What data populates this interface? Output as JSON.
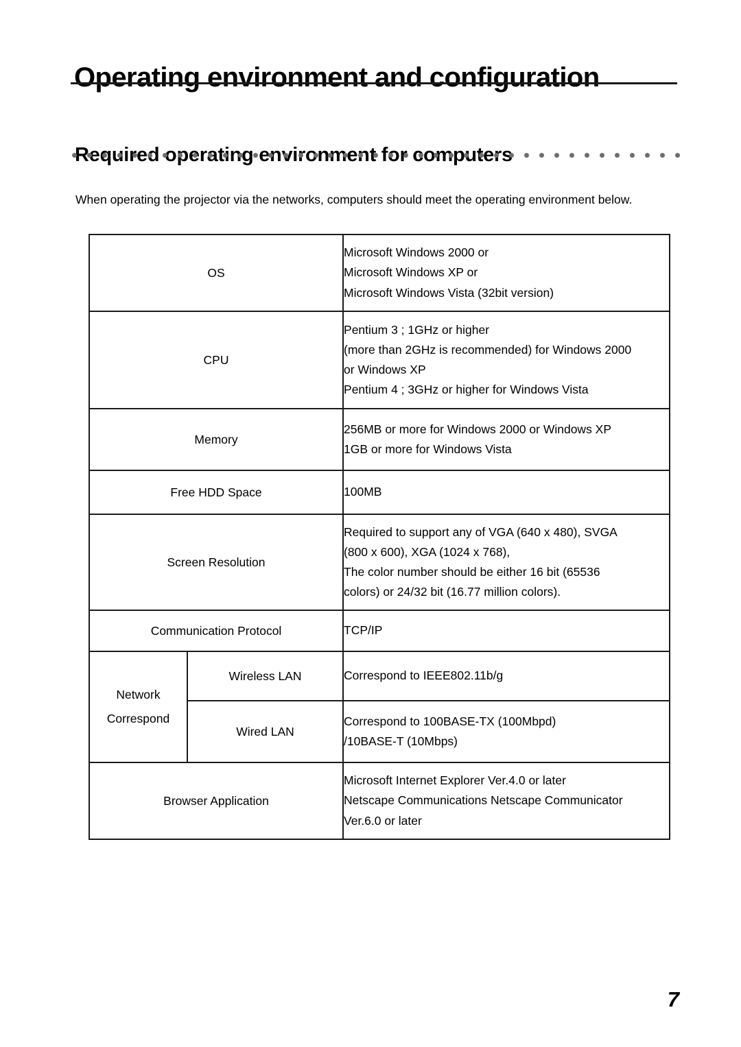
{
  "page": {
    "title": "Operating environment and configuration",
    "section_heading": "Required operating environment for computers",
    "intro_line1": "When operating the projector via the networks, computers should meet the operating environment",
    "intro_line2": "below.",
    "page_number": "7",
    "rule_color": "#1a1a1a",
    "dot_color": "#6e6e6e",
    "dot_count": 41
  },
  "spec_table": {
    "rows": [
      {
        "label": "OS",
        "value_lines": [
          "Microsoft Windows 2000 or",
          "Microsoft Windows XP or",
          "Microsoft Windows Vista (32bit version)"
        ]
      },
      {
        "label": "CPU",
        "value_lines": [
          "Pentium 3 ;  1GHz or higher",
          "(more than 2GHz is recommended) for Windows 2000",
          "or Windows XP",
          "Pentium 4 ;  3GHz or higher  for Windows Vista"
        ]
      },
      {
        "label": "Memory",
        "value_lines": [
          "256MB or more for Windows 2000 or Windows XP",
          "1GB or more for Windows Vista"
        ]
      },
      {
        "label": "Free HDD Space",
        "value_lines": [
          "100MB"
        ]
      },
      {
        "label": "Screen Resolution",
        "value_lines": [
          "Required to support any of VGA (640 x 480), SVGA",
          "(800 x 600), XGA (1024 x 768),",
          "The color number should be either 16 bit (65536",
          "colors) or 24/32 bit (16.77 million colors)."
        ]
      },
      {
        "label": "Communication Protocol",
        "value_lines": [
          "TCP/IP"
        ]
      },
      {
        "label_line1": "Network",
        "label_line2": "Correspond",
        "sub_rows": [
          {
            "sub_label": "Wireless LAN",
            "value_lines": [
              "Correspond to IEEE802.11b/g"
            ]
          },
          {
            "sub_label": "Wired LAN",
            "value_lines": [
              "Correspond to 100BASE-TX (100Mbpd)",
              "/10BASE-T (10Mbps)"
            ]
          }
        ]
      },
      {
        "label": "Browser Application",
        "value_lines": [
          "Microsoft Internet Explorer Ver.4.0 or later",
          "Netscape Communications Netscape Communicator",
          "Ver.6.0 or later"
        ]
      }
    ]
  }
}
